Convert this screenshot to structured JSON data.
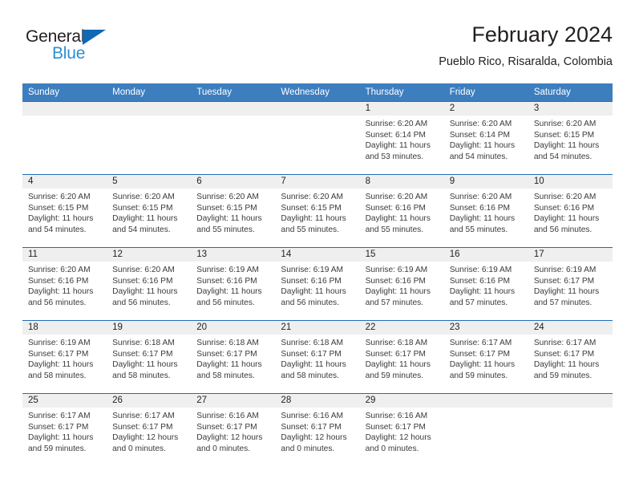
{
  "brand": {
    "name_dark": "General",
    "name_light": "Blue",
    "triangle_color": "#1168b3",
    "light_color": "#2a8fd4"
  },
  "header": {
    "title": "February 2024",
    "subtitle": "Pueblo Rico, Risaralda, Colombia",
    "header_bg": "#3d7ebf",
    "row_line_color": "#1f6eb5",
    "daynum_band_color": "#efefef"
  },
  "weekdays": [
    "Sunday",
    "Monday",
    "Tuesday",
    "Wednesday",
    "Thursday",
    "Friday",
    "Saturday"
  ],
  "weeks": [
    [
      {
        "day": "",
        "sunrise": "",
        "sunset": "",
        "daylight": ""
      },
      {
        "day": "",
        "sunrise": "",
        "sunset": "",
        "daylight": ""
      },
      {
        "day": "",
        "sunrise": "",
        "sunset": "",
        "daylight": ""
      },
      {
        "day": "",
        "sunrise": "",
        "sunset": "",
        "daylight": ""
      },
      {
        "day": "1",
        "sunrise": "Sunrise: 6:20 AM",
        "sunset": "Sunset: 6:14 PM",
        "daylight": "Daylight: 11 hours and 53 minutes."
      },
      {
        "day": "2",
        "sunrise": "Sunrise: 6:20 AM",
        "sunset": "Sunset: 6:14 PM",
        "daylight": "Daylight: 11 hours and 54 minutes."
      },
      {
        "day": "3",
        "sunrise": "Sunrise: 6:20 AM",
        "sunset": "Sunset: 6:15 PM",
        "daylight": "Daylight: 11 hours and 54 minutes."
      }
    ],
    [
      {
        "day": "4",
        "sunrise": "Sunrise: 6:20 AM",
        "sunset": "Sunset: 6:15 PM",
        "daylight": "Daylight: 11 hours and 54 minutes."
      },
      {
        "day": "5",
        "sunrise": "Sunrise: 6:20 AM",
        "sunset": "Sunset: 6:15 PM",
        "daylight": "Daylight: 11 hours and 54 minutes."
      },
      {
        "day": "6",
        "sunrise": "Sunrise: 6:20 AM",
        "sunset": "Sunset: 6:15 PM",
        "daylight": "Daylight: 11 hours and 55 minutes."
      },
      {
        "day": "7",
        "sunrise": "Sunrise: 6:20 AM",
        "sunset": "Sunset: 6:15 PM",
        "daylight": "Daylight: 11 hours and 55 minutes."
      },
      {
        "day": "8",
        "sunrise": "Sunrise: 6:20 AM",
        "sunset": "Sunset: 6:16 PM",
        "daylight": "Daylight: 11 hours and 55 minutes."
      },
      {
        "day": "9",
        "sunrise": "Sunrise: 6:20 AM",
        "sunset": "Sunset: 6:16 PM",
        "daylight": "Daylight: 11 hours and 55 minutes."
      },
      {
        "day": "10",
        "sunrise": "Sunrise: 6:20 AM",
        "sunset": "Sunset: 6:16 PM",
        "daylight": "Daylight: 11 hours and 56 minutes."
      }
    ],
    [
      {
        "day": "11",
        "sunrise": "Sunrise: 6:20 AM",
        "sunset": "Sunset: 6:16 PM",
        "daylight": "Daylight: 11 hours and 56 minutes."
      },
      {
        "day": "12",
        "sunrise": "Sunrise: 6:20 AM",
        "sunset": "Sunset: 6:16 PM",
        "daylight": "Daylight: 11 hours and 56 minutes."
      },
      {
        "day": "13",
        "sunrise": "Sunrise: 6:19 AM",
        "sunset": "Sunset: 6:16 PM",
        "daylight": "Daylight: 11 hours and 56 minutes."
      },
      {
        "day": "14",
        "sunrise": "Sunrise: 6:19 AM",
        "sunset": "Sunset: 6:16 PM",
        "daylight": "Daylight: 11 hours and 56 minutes."
      },
      {
        "day": "15",
        "sunrise": "Sunrise: 6:19 AM",
        "sunset": "Sunset: 6:16 PM",
        "daylight": "Daylight: 11 hours and 57 minutes."
      },
      {
        "day": "16",
        "sunrise": "Sunrise: 6:19 AM",
        "sunset": "Sunset: 6:16 PM",
        "daylight": "Daylight: 11 hours and 57 minutes."
      },
      {
        "day": "17",
        "sunrise": "Sunrise: 6:19 AM",
        "sunset": "Sunset: 6:17 PM",
        "daylight": "Daylight: 11 hours and 57 minutes."
      }
    ],
    [
      {
        "day": "18",
        "sunrise": "Sunrise: 6:19 AM",
        "sunset": "Sunset: 6:17 PM",
        "daylight": "Daylight: 11 hours and 58 minutes."
      },
      {
        "day": "19",
        "sunrise": "Sunrise: 6:18 AM",
        "sunset": "Sunset: 6:17 PM",
        "daylight": "Daylight: 11 hours and 58 minutes."
      },
      {
        "day": "20",
        "sunrise": "Sunrise: 6:18 AM",
        "sunset": "Sunset: 6:17 PM",
        "daylight": "Daylight: 11 hours and 58 minutes."
      },
      {
        "day": "21",
        "sunrise": "Sunrise: 6:18 AM",
        "sunset": "Sunset: 6:17 PM",
        "daylight": "Daylight: 11 hours and 58 minutes."
      },
      {
        "day": "22",
        "sunrise": "Sunrise: 6:18 AM",
        "sunset": "Sunset: 6:17 PM",
        "daylight": "Daylight: 11 hours and 59 minutes."
      },
      {
        "day": "23",
        "sunrise": "Sunrise: 6:17 AM",
        "sunset": "Sunset: 6:17 PM",
        "daylight": "Daylight: 11 hours and 59 minutes."
      },
      {
        "day": "24",
        "sunrise": "Sunrise: 6:17 AM",
        "sunset": "Sunset: 6:17 PM",
        "daylight": "Daylight: 11 hours and 59 minutes."
      }
    ],
    [
      {
        "day": "25",
        "sunrise": "Sunrise: 6:17 AM",
        "sunset": "Sunset: 6:17 PM",
        "daylight": "Daylight: 11 hours and 59 minutes."
      },
      {
        "day": "26",
        "sunrise": "Sunrise: 6:17 AM",
        "sunset": "Sunset: 6:17 PM",
        "daylight": "Daylight: 12 hours and 0 minutes."
      },
      {
        "day": "27",
        "sunrise": "Sunrise: 6:16 AM",
        "sunset": "Sunset: 6:17 PM",
        "daylight": "Daylight: 12 hours and 0 minutes."
      },
      {
        "day": "28",
        "sunrise": "Sunrise: 6:16 AM",
        "sunset": "Sunset: 6:17 PM",
        "daylight": "Daylight: 12 hours and 0 minutes."
      },
      {
        "day": "29",
        "sunrise": "Sunrise: 6:16 AM",
        "sunset": "Sunset: 6:17 PM",
        "daylight": "Daylight: 12 hours and 0 minutes."
      },
      {
        "day": "",
        "sunrise": "",
        "sunset": "",
        "daylight": ""
      },
      {
        "day": "",
        "sunrise": "",
        "sunset": "",
        "daylight": ""
      }
    ]
  ]
}
